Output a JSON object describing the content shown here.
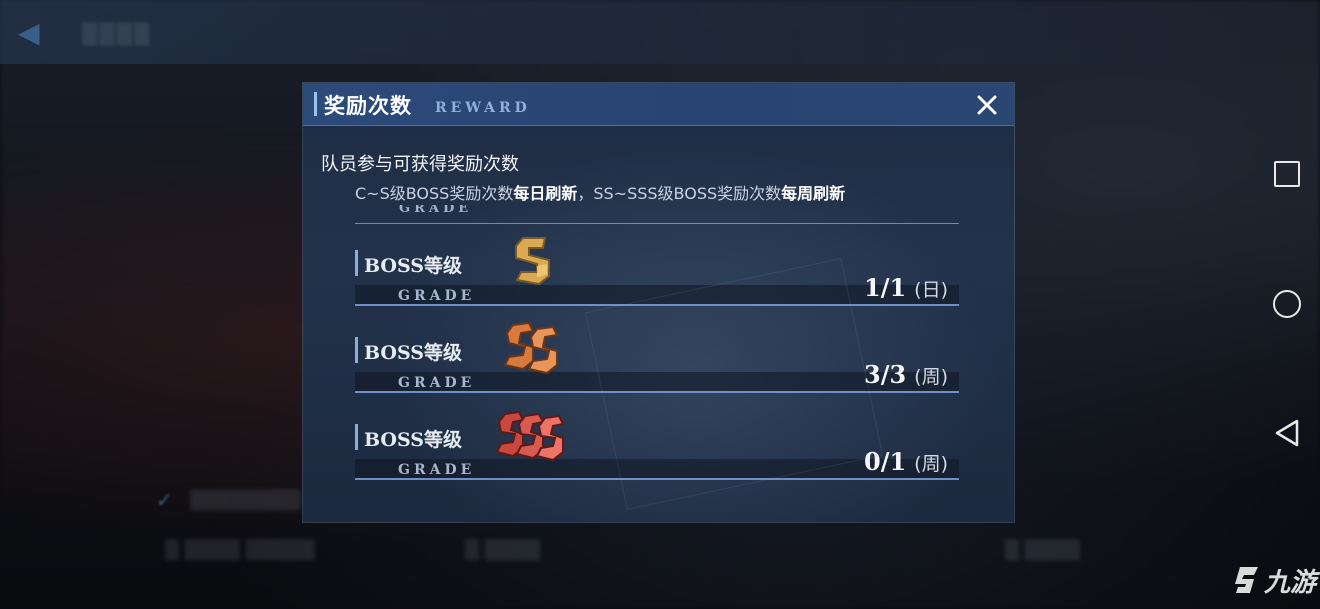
{
  "dialog": {
    "title": "奖励次数",
    "subtitle": "REWARD",
    "description": "队员参与可获得奖励次数",
    "note_parts": [
      "C~S级BOSS奖励次数",
      "每日刷新",
      "，SS~SSS级BOSS奖励次数",
      "每周刷新"
    ],
    "header_cut_label": "GRADE",
    "rows": [
      {
        "label": "BOSS等级",
        "grade_label": "GRADE",
        "rank": "S",
        "count": "1/1",
        "period": "(日)",
        "color": "#d9a954"
      },
      {
        "label": "BOSS等级",
        "grade_label": "GRADE",
        "rank": "SS",
        "count": "3/3",
        "period": "(周)",
        "color": "#e08a4a"
      },
      {
        "label": "BOSS等级",
        "grade_label": "GRADE",
        "rank": "SSS",
        "count": "0/1",
        "period": "(周)",
        "color": "#e0605a"
      }
    ]
  },
  "watermark": {
    "text": "九游"
  },
  "nav": {
    "icons": [
      "square-icon",
      "circle-icon",
      "back-triangle-icon"
    ]
  }
}
